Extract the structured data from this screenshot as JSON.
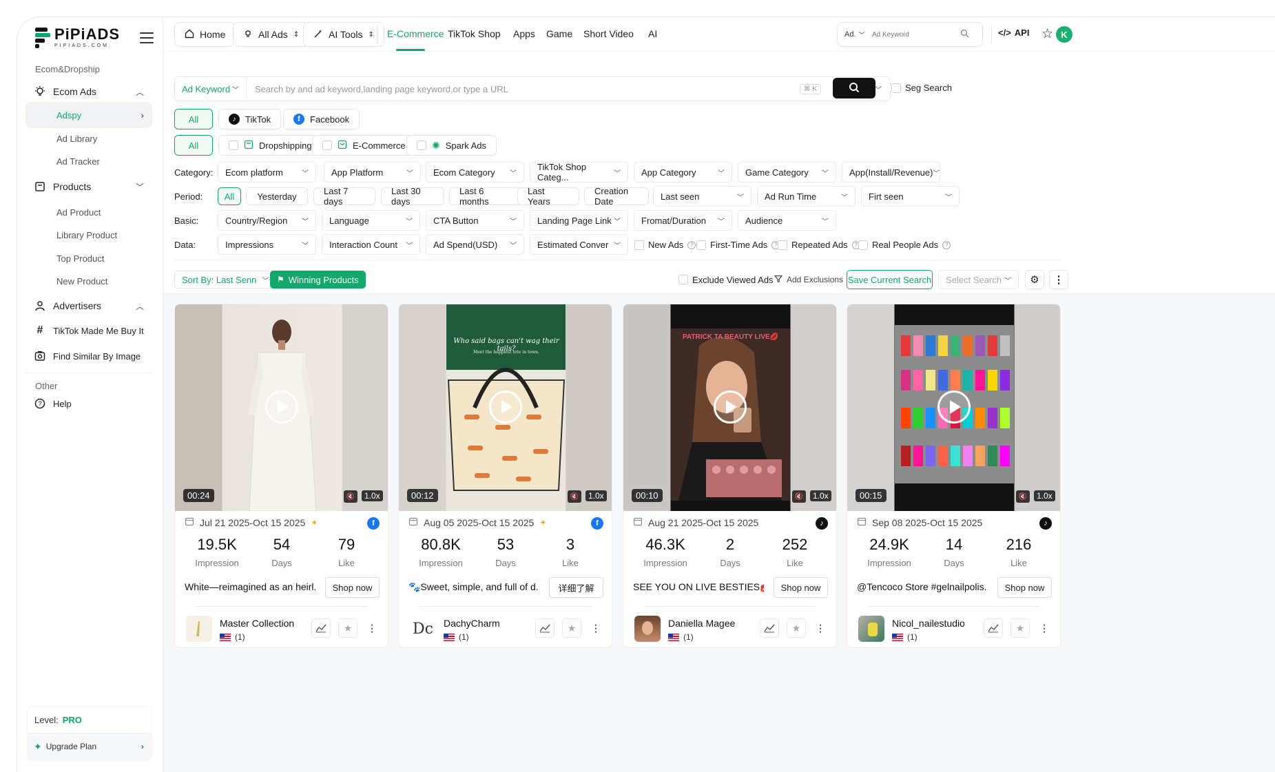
{
  "brand": {
    "name": "PiPiADS",
    "sub": "PIPIADS.COM"
  },
  "sidebar": {
    "section1": "Ecom&Dropship",
    "ecom_ads": "Ecom Ads",
    "adspy": "Adspy",
    "ad_library": "Ad Library",
    "ad_tracker": "Ad Tracker",
    "products": "Products",
    "ad_product": "Ad Product",
    "library_product": "Library Product",
    "top_product": "Top Product",
    "new_product": "New Product",
    "advertisers": "Advertisers",
    "tiktok_made": "TikTok Made Me Buy It",
    "find_similar": "Find Similar By Image",
    "section2": "Other",
    "help": "Help",
    "level_label": "Level:",
    "level_value": "PRO",
    "upgrade": "Upgrade Plan"
  },
  "topbar": {
    "home": "Home",
    "all_ads": "All Ads",
    "ai_tools": "AI Tools",
    "tabs": [
      "E-Commerce",
      "TikTok Shop",
      "Apps",
      "Game",
      "Short Video",
      "AI"
    ],
    "search_type": "Ad.",
    "search_placeholder": "Ad Keyword",
    "api": "API",
    "avatar_letter": "K"
  },
  "search": {
    "keyword_type": "Ad Keyword",
    "placeholder": "Search by and ad keyword,landing page keyword,or type a URL",
    "shortcut": "⌘ K",
    "seg_search": "Seg Search"
  },
  "platforms": {
    "all": "All",
    "tiktok": "TikTok",
    "facebook": "Facebook"
  },
  "types": {
    "all": "All",
    "dropshipping": "Dropshipping",
    "ecommerce": "E-Commerce",
    "spark": "Spark Ads"
  },
  "filters": {
    "category_label": "Category:",
    "category": [
      "Ecom platform",
      "App Platform",
      "Ecom Category",
      "TikTok Shop Categ...",
      "App Category",
      "Game Category",
      "App(Install/Revenue)"
    ],
    "period_label": "Period:",
    "period": [
      "All",
      "Yesterday",
      "Last 7 days",
      "Last 30 days",
      "Last 6 months",
      "Last Years",
      "Creation Date"
    ],
    "period_selects": [
      "Last seen",
      "Ad Run Time",
      "Firt seen"
    ],
    "basic_label": "Basic:",
    "basic": [
      "Country/Region",
      "Language",
      "CTA Button",
      "Landing Page Link",
      "Fromat/Duration",
      "Audience"
    ],
    "data_label": "Data:",
    "data": [
      "Impressions",
      "Interaction Count",
      "Ad Spend(USD)",
      "Estimated Conver"
    ],
    "data_checks": [
      "New Ads",
      "First-Time Ads",
      "Repeated Ads",
      "Real People Ads"
    ]
  },
  "toolbar": {
    "sort": "Sort By: Last Senn",
    "winning": "Winning Products",
    "exclude": "Exclude Viewed Ads",
    "add_excl": "Add Exclusions",
    "save": "Save Current Search",
    "select_search": "Select Search"
  },
  "cards": [
    {
      "duration": "00:24",
      "speed": "1.0x",
      "date": "Jul 21 2025-Oct 15 2025",
      "platform": "facebook",
      "impression": "19.5K",
      "days": "54",
      "like": "79",
      "desc": "White—reimagined as an heirl...",
      "cta": "Shop now",
      "advertiser": "Master Collection",
      "country_count": "(1)"
    },
    {
      "duration": "00:12",
      "speed": "1.0x",
      "date": "Aug 05 2025-Oct 15 2025",
      "platform": "facebook",
      "impression": "80.8K",
      "days": "53",
      "like": "3",
      "desc": "🐾Sweet, simple, and full of d...",
      "cta": "详细了解",
      "advertiser": "DachyCharm",
      "country_count": "(1)",
      "overlay_text": "Who said bags can't wag their tails?",
      "overlay_sub": "Meet the happiest tote in town."
    },
    {
      "duration": "00:10",
      "speed": "1.0x",
      "date": "Aug 21 2025-Oct 15 2025",
      "platform": "tiktok",
      "impression": "46.3K",
      "days": "2",
      "like": "252",
      "desc": "SEE YOU ON LIVE BESTIES💋 ...",
      "cta": "Shop now",
      "advertiser": "Daniella Magee",
      "country_count": "(1)",
      "overlay_text": "PATRICK TA BEAUTY LIVE💋"
    },
    {
      "duration": "00:15",
      "speed": "1.0x",
      "date": "Sep 08 2025-Oct 15 2025",
      "platform": "tiktok",
      "impression": "24.9K",
      "days": "14",
      "like": "216",
      "desc": "@Tencoco Store #gelnailpolis...",
      "cta": "Shop now",
      "advertiser": "Nicol_nailestudio",
      "country_count": "(1)"
    }
  ],
  "stat_labels": {
    "impression": "Impression",
    "days": "Days",
    "like": "Like"
  },
  "colors": {
    "accent": "#16a36a",
    "facebook": "#1877f2",
    "tiktok": "#111111"
  }
}
